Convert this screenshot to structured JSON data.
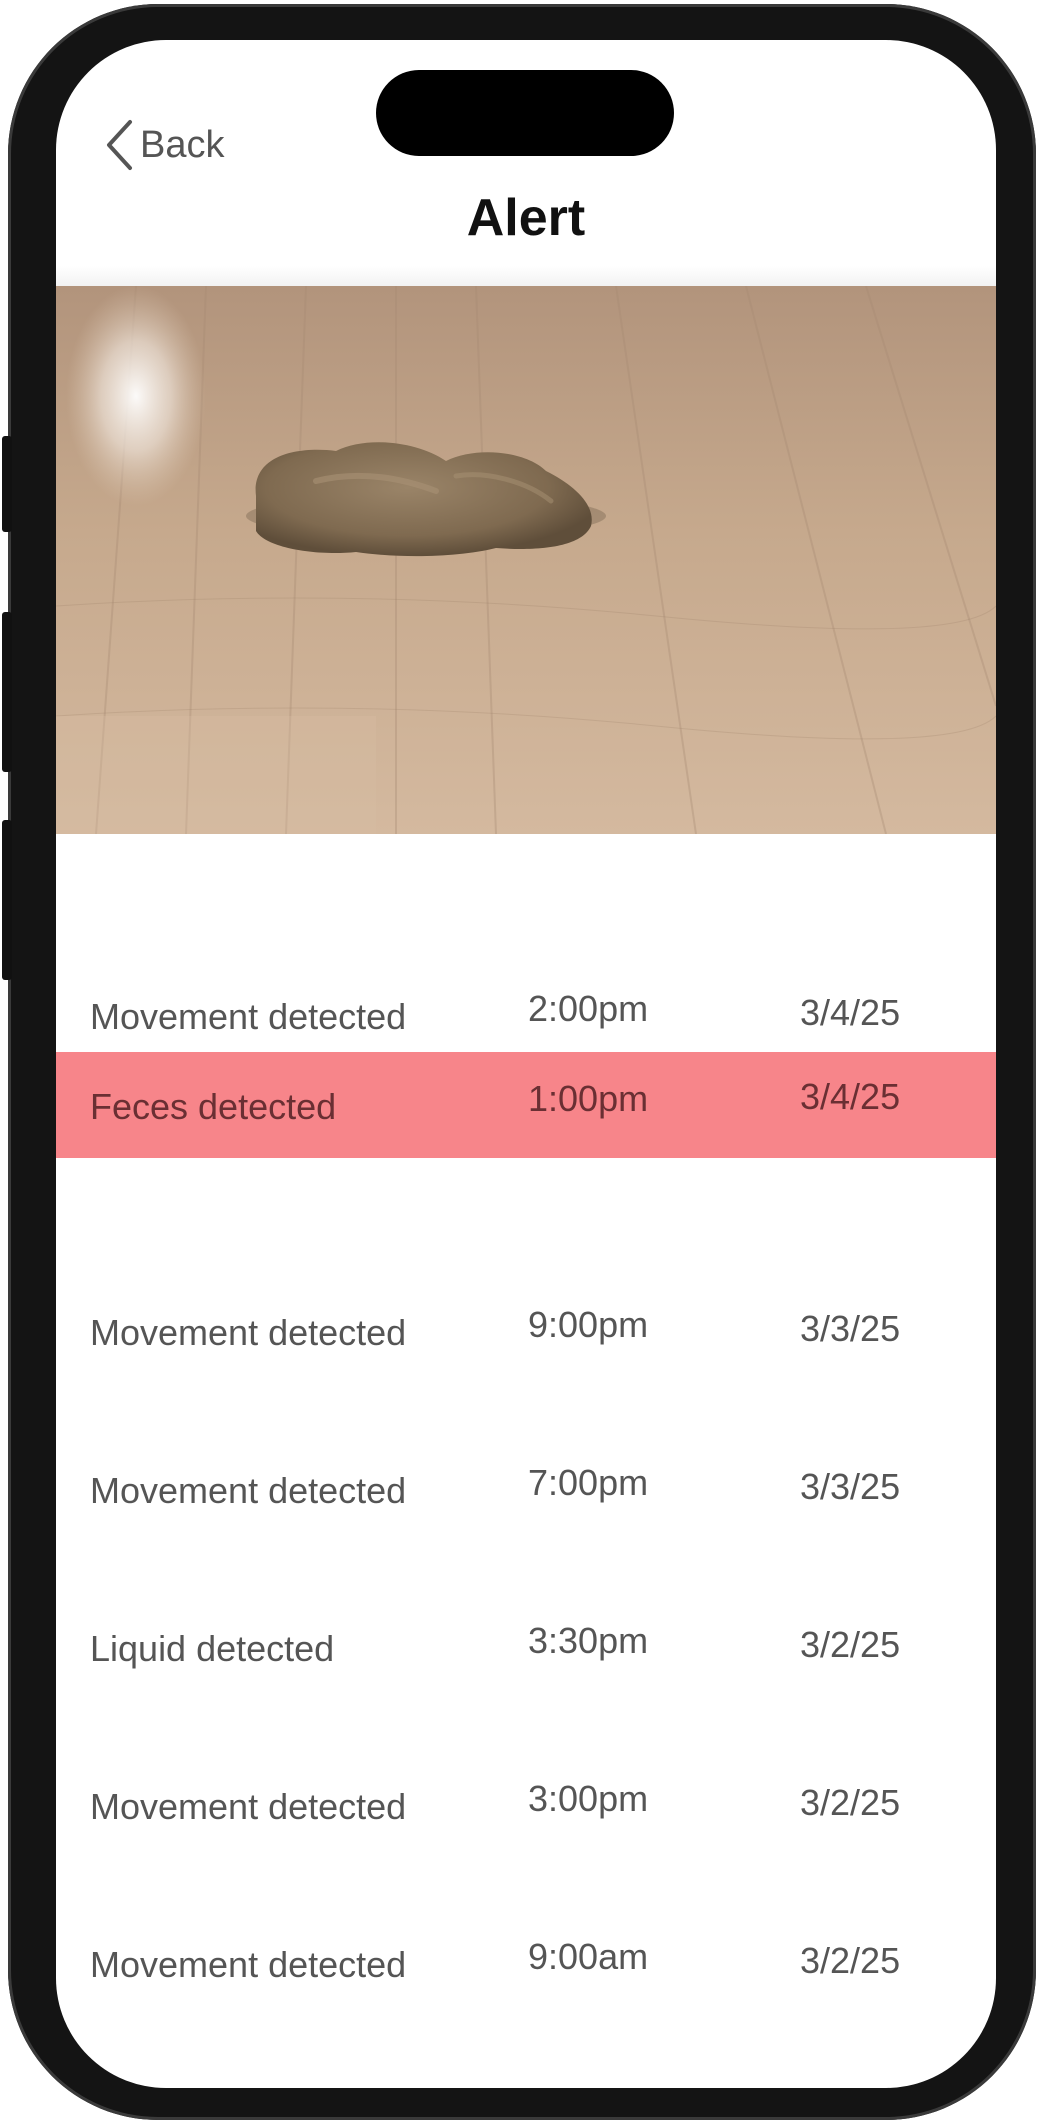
{
  "header": {
    "back_label": "Back",
    "title": "Alert"
  },
  "photo": {
    "icon": "feces-on-wood-floor-photo"
  },
  "colors": {
    "highlight": "#f7858a",
    "text": "#555555",
    "title": "#111111"
  },
  "alerts": [
    {
      "event": "Movement detected",
      "time": "2:00pm",
      "date": "3/4/25",
      "highlighted": false
    },
    {
      "event": "Feces detected",
      "time": "1:00pm",
      "date": "3/4/25",
      "highlighted": true
    },
    {
      "event": "Movement detected",
      "time": "9:00pm",
      "date": "3/3/25",
      "highlighted": false
    },
    {
      "event": "Movement detected",
      "time": "7:00pm",
      "date": "3/3/25",
      "highlighted": false
    },
    {
      "event": "Liquid detected",
      "time": "3:30pm",
      "date": "3/2/25",
      "highlighted": false
    },
    {
      "event": "Movement detected",
      "time": "3:00pm",
      "date": "3/2/25",
      "highlighted": false
    },
    {
      "event": "Movement detected",
      "time": "9:00am",
      "date": "3/2/25",
      "highlighted": false
    }
  ]
}
